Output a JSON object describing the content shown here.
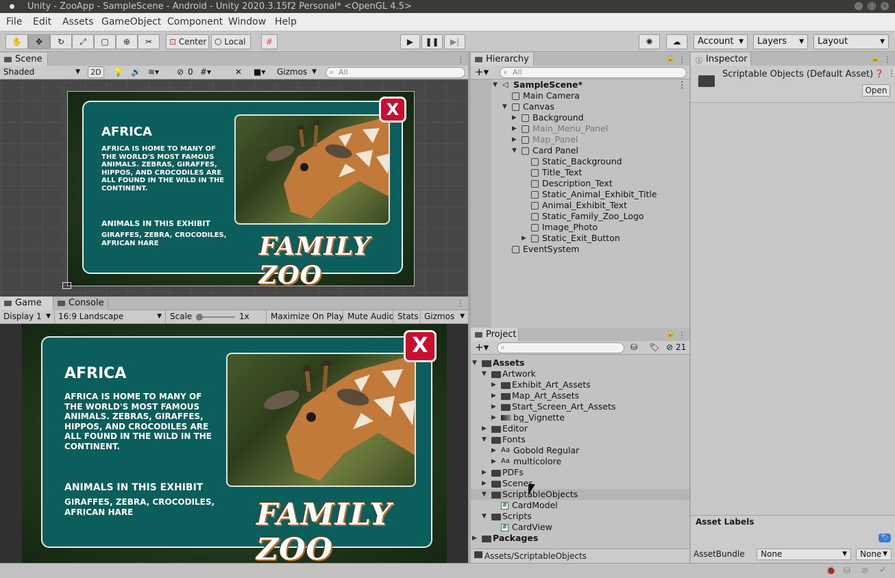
{
  "window": {
    "title": "Unity - ZooApp - SampleScene - Android - Unity 2020.3.15f2 Personal* <OpenGL 4.5>"
  },
  "menu": [
    "File",
    "Edit",
    "Assets",
    "GameObject",
    "Component",
    "Window",
    "Help"
  ],
  "toolbar": {
    "pivot": "Center",
    "space": "Local",
    "account": "Account",
    "layers": "Layers",
    "layout": "Layout"
  },
  "scene": {
    "tab": "Scene",
    "shading": "Shaded",
    "mode2d": "2D",
    "hidden_count": "0",
    "gizmos": "Gizmos",
    "search_placeholder": "All"
  },
  "game": {
    "tab": "Game",
    "console_tab": "Console",
    "display": "Display 1",
    "aspect": "16:9 Landscape",
    "scale_label": "Scale",
    "scale_value": "1x",
    "maximize": "Maximize On Play",
    "mute": "Mute Audio",
    "stats": "Stats",
    "gizmos": "Gizmos"
  },
  "card": {
    "title": "AFRICA",
    "description": "AFRICA IS HOME TO MANY OF THE WORLD'S MOST FAMOUS ANIMALS. ZEBRAS, GIRAFFES, HIPPOS, AND CROCODILES ARE ALL FOUND IN THE WILD IN THE CONTINENT.",
    "exhibit_title": "ANIMALS IN THIS EXHIBIT",
    "exhibit_text": "GIRAFFES, ZEBRA, CROCODILES, AFRICAN HARE",
    "logo": "FAMILY ZOO",
    "close": "X"
  },
  "hierarchy": {
    "tab": "Hierarchy",
    "search_placeholder": "All",
    "items": [
      {
        "label": "SampleScene*",
        "bold": true
      },
      {
        "label": "Main Camera"
      },
      {
        "label": "Canvas"
      },
      {
        "label": "Background"
      },
      {
        "label": "Main_Menu_Panel",
        "dim": true
      },
      {
        "label": "Map_Panel",
        "dim": true
      },
      {
        "label": "Card Panel"
      },
      {
        "label": "Static_Background"
      },
      {
        "label": "Title_Text"
      },
      {
        "label": "Description_Text"
      },
      {
        "label": "Static_Animal_Exhibit_Title"
      },
      {
        "label": "Animal_Exhibit_Text"
      },
      {
        "label": "Static_Family_Zoo_Logo"
      },
      {
        "label": "Image_Photo"
      },
      {
        "label": "Static_Exit_Button"
      },
      {
        "label": "EventSystem"
      }
    ]
  },
  "project": {
    "tab": "Project",
    "hidden_count": "21",
    "path": "Assets/ScriptableObjects",
    "items": [
      {
        "label": "Assets",
        "bold": true
      },
      {
        "label": "Artwork"
      },
      {
        "label": "Exhibit_Art_Assets"
      },
      {
        "label": "Map_Art_Assets"
      },
      {
        "label": "Start_Screen_Art_Assets"
      },
      {
        "label": "bg_Vignette"
      },
      {
        "label": "Editor"
      },
      {
        "label": "Fonts"
      },
      {
        "label": "Gobold Regular"
      },
      {
        "label": "multicolore"
      },
      {
        "label": "PDFs"
      },
      {
        "label": "Scenes"
      },
      {
        "label": "ScriptableObjects",
        "selected": true
      },
      {
        "label": "CardModel"
      },
      {
        "label": "Scripts"
      },
      {
        "label": "CardView"
      },
      {
        "label": "Packages",
        "bold": true
      }
    ]
  },
  "inspector": {
    "tab": "Inspector",
    "asset_title": "Scriptable Objects (Default Asset)",
    "open_button": "Open",
    "asset_labels": "Asset Labels",
    "assetbundle_label": "AssetBundle",
    "assetbundle_value": "None",
    "variant_value": "None"
  },
  "colors": {
    "card_teal": "#0c5e5c",
    "close_red": "#c8102e",
    "scene_bg": "#474747",
    "panel_gray": "#c2c2c2",
    "selection": "#c9c9c9"
  }
}
